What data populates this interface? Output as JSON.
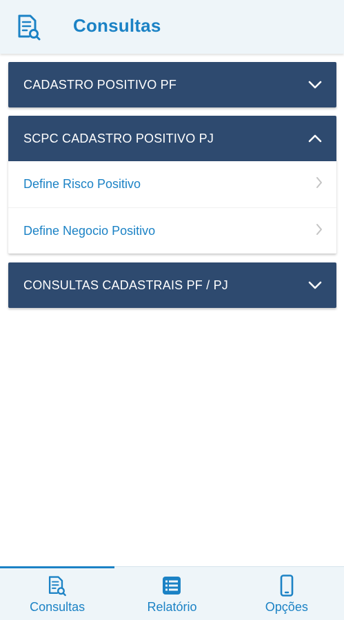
{
  "colors": {
    "accent": "#1b82c5",
    "accordion_header": "#2e4a6f",
    "header_background": "#eef5f9"
  },
  "header": {
    "title": "Consultas",
    "icon": "document-search-icon"
  },
  "sections": [
    {
      "title": "CADASTRO POSITIVO PF",
      "expanded": false,
      "chevron": "chevron-down-icon",
      "items": []
    },
    {
      "title": "SCPC CADASTRO POSITIVO PJ",
      "expanded": true,
      "chevron": "chevron-up-icon",
      "items": [
        {
          "label": "Define Risco Positivo",
          "icon": "chevron-right-icon"
        },
        {
          "label": "Define Negocio Positivo",
          "icon": "chevron-right-icon"
        }
      ]
    },
    {
      "title": "CONSULTAS CADASTRAIS PF / PJ",
      "expanded": false,
      "chevron": "chevron-down-icon",
      "items": []
    }
  ],
  "bottom_nav": {
    "items": [
      {
        "label": "Consultas",
        "icon": "document-search-icon",
        "active": true
      },
      {
        "label": "Relatório",
        "icon": "list-icon",
        "active": false
      },
      {
        "label": "Opções",
        "icon": "smartphone-icon",
        "active": false
      }
    ]
  }
}
